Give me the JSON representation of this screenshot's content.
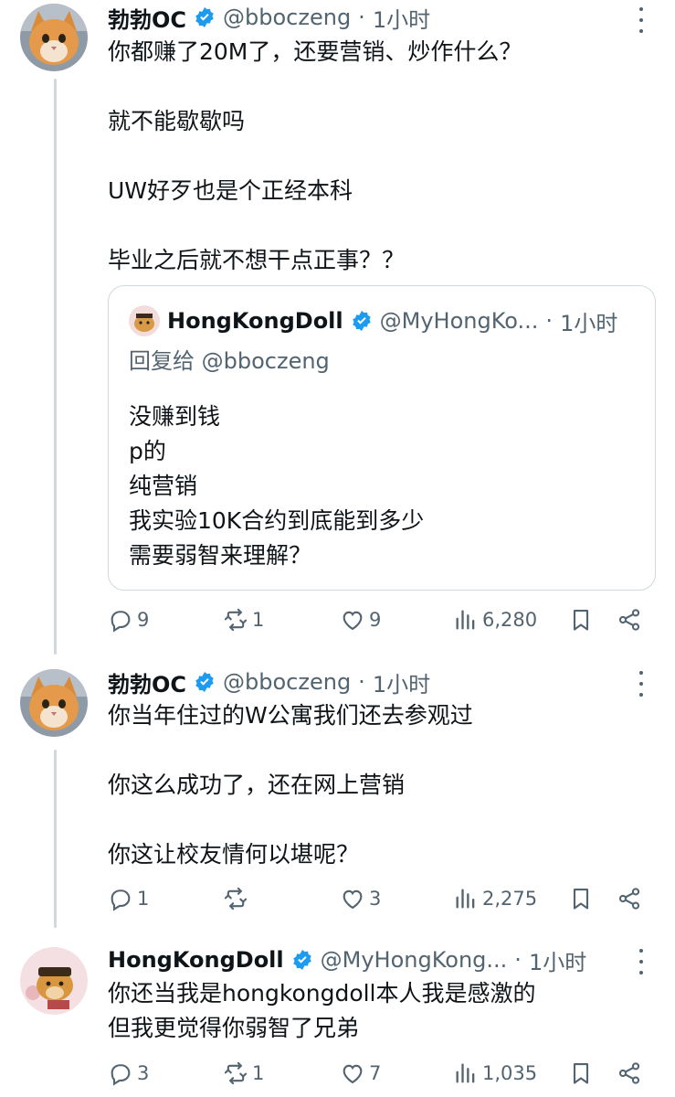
{
  "colors": {
    "verified": "#1d9bf0",
    "text": "#0f1419",
    "muted": "#536471",
    "border": "#cfd9de"
  },
  "tweets": [
    {
      "name": "勃勃OC",
      "handle": "@bboczeng",
      "sep": "·",
      "time": "1小时",
      "text": "你都赚了20M了，还要营销、炒作什么？\n\n就不能歇歇吗\n\nUW好歹也是个正经本科\n\n毕业之后就不想干点正事？？",
      "quote": {
        "name": "HongKongDoll",
        "handle": "@MyHongKo...",
        "sep": "·",
        "time": "1小时",
        "reply_to": "回复给 @bboczeng",
        "text": "没赚到钱\np的\n纯营销\n我实验10K合约到底能到多少\n需要弱智来理解？"
      },
      "actions": {
        "replies": "9",
        "retweets": "1",
        "likes": "9",
        "views": "6,280"
      }
    },
    {
      "name": "勃勃OC",
      "handle": "@bboczeng",
      "sep": "·",
      "time": "1小时",
      "text": "你当年住过的W公寓我们还去参观过\n\n你这么成功了，还在网上营销\n\n你这让校友情何以堪呢？",
      "actions": {
        "replies": "1",
        "retweets": "",
        "likes": "3",
        "views": "2,275"
      }
    },
    {
      "name": "HongKongDoll",
      "handle": "@MyHongKong...",
      "sep": "·",
      "time": "1小时",
      "text": "你还当我是hongkongdoll本人我是感激的\n但我更觉得你弱智了兄弟",
      "actions": {
        "replies": "3",
        "retweets": "1",
        "likes": "7",
        "views": "1,035"
      }
    }
  ]
}
